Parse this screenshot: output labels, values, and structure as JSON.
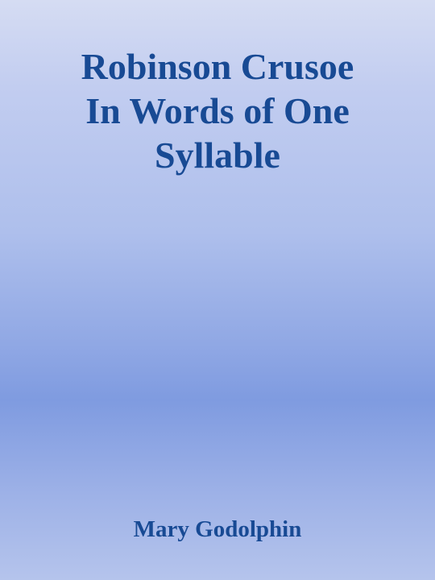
{
  "cover": {
    "title_lines": [
      "Robinson Crusoe",
      "In Words of One",
      "Syllable"
    ],
    "author": "Mary Godolphin",
    "text_color": "#184a94",
    "background_colors": [
      "#d5dcf3",
      "#7f9be0",
      "#b5c4ec"
    ]
  }
}
